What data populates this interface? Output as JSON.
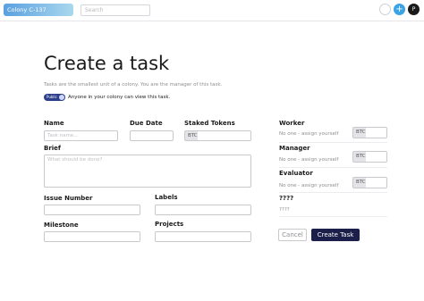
{
  "header": {
    "colony_name": "Colony C-137",
    "search_placeholder": "Search",
    "plus_symbol": "+",
    "avatar_initial": "P"
  },
  "page": {
    "title": "Create a task",
    "subtitle": "Tasks are the smallest unit of a colony. You are the manager of this task.",
    "public_toggle_label": "Public",
    "public_text": "Anyone in your colony can view this task."
  },
  "form": {
    "name_label": "Name",
    "name_placeholder": "Task name...",
    "due_date_label": "Due Date",
    "staked_tokens_label": "Staked Tokens",
    "staked_token_symbol": "BTC",
    "brief_label": "Brief",
    "brief_placeholder": "What should be done?",
    "issue_number_label": "Issue Number",
    "labels_label": "Labels",
    "milestone_label": "Milestone",
    "projects_label": "Projects"
  },
  "roles": {
    "worker_label": "Worker",
    "worker_sub": "No one - assign yourself",
    "worker_token": "BTC",
    "manager_label": "Manager",
    "manager_sub": "No one - assign yourself",
    "manager_token": "BTC",
    "evaluator_label": "Evaluator",
    "evaluator_sub": "No one - assign yourself",
    "evaluator_token": "BTC",
    "unknown_label": "????",
    "unknown_sub": "????"
  },
  "actions": {
    "cancel_label": "Cancel",
    "create_label": "Create Task"
  },
  "colors": {
    "accent": "#1c1f4a",
    "toggle": "#2c3f8a",
    "brand_gradient_start": "#5aa0e0",
    "plus_button": "#3aa4e5"
  }
}
